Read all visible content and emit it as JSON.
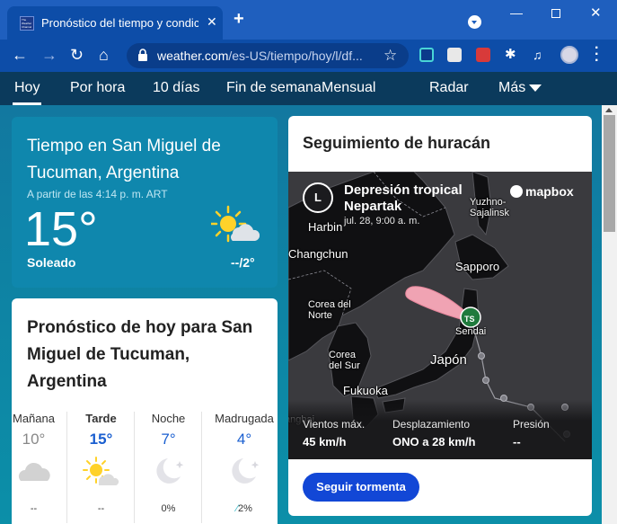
{
  "browser": {
    "tab_title": "Pronóstico del tiempo y condiciones",
    "favicon_text": "The Weather Channel",
    "url_host": "weather.com",
    "url_path": "/es-US/tiempo/hoy/l/df..."
  },
  "site_nav": {
    "items": [
      {
        "label": "Hoy",
        "active": true
      },
      {
        "label": "Por hora"
      },
      {
        "label": "10 días"
      },
      {
        "label": "Fin de semana"
      },
      {
        "label": "Mensual"
      },
      {
        "label": "Radar"
      },
      {
        "label": "Más"
      }
    ]
  },
  "current": {
    "title": "Tiempo en San Miguel de Tucuman, Argentina",
    "as_of": "A partir de las 4:14 p. m. ART",
    "temperature": "15°",
    "condition": "Soleado",
    "hi_lo": "--/2°",
    "icon": "partly-sunny-icon"
  },
  "today": {
    "title": "Pronóstico de hoy para San Miguel de Tucuman, Argentina",
    "periods": [
      {
        "name": "Mañana",
        "temp": "10°",
        "icon": "cloud-icon",
        "precip": "--"
      },
      {
        "name": "Tarde",
        "temp": "15°",
        "icon": "sun-cloud-icon",
        "precip": "--",
        "highlight": true
      },
      {
        "name": "Noche",
        "temp": "7°",
        "icon": "moon-icon",
        "precip": "0%"
      },
      {
        "name": "Madrugada",
        "temp": "4°",
        "icon": "moon-icon",
        "precip": "2%"
      }
    ],
    "colors": {
      "highlight": "#1a5fd0",
      "temp": "#888888"
    }
  },
  "hurricane": {
    "title": "Seguimiento de huracán",
    "badge": "L",
    "storm_name": "Depresión tropical Nepartak",
    "storm_date": "jul. 28, 9:00 a. m.",
    "attribution": "mapbox",
    "map_labels": {
      "yuzhno": "Yuzhno-Sajalinsk",
      "harbin": "Harbin",
      "changchun": "Changchun",
      "sapporo": "Sapporo",
      "corea_norte": "Corea del Norte",
      "ts": "TS",
      "sendai": "Sendai",
      "corea_sur": "Corea del Sur",
      "japon": "Japón",
      "fukuoka": "Fukuoka",
      "left_edge": "anghai"
    },
    "stats": [
      {
        "label": "Vientos máx.",
        "value": "45 km/h"
      },
      {
        "label": "Desplazamiento",
        "value": "ONO a 28 km/h"
      },
      {
        "label": "Presión",
        "value": "--"
      }
    ],
    "button": "Seguir tormenta"
  }
}
